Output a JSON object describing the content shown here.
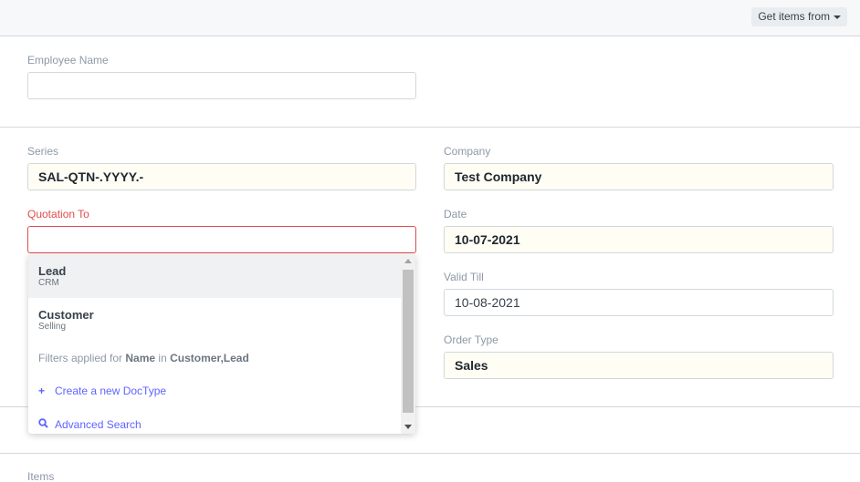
{
  "toolbar": {
    "get_items_label": "Get items from"
  },
  "employee": {
    "label": "Employee Name",
    "value": ""
  },
  "series": {
    "label": "Series",
    "value": "SAL-QTN-.YYYY.-"
  },
  "quotation_to": {
    "label": "Quotation To",
    "value": ""
  },
  "company": {
    "label": "Company",
    "value": "Test Company"
  },
  "date": {
    "label": "Date",
    "value": "10-07-2021"
  },
  "valid_till": {
    "label": "Valid Till",
    "value": "10-08-2021"
  },
  "order_type": {
    "label": "Order Type",
    "value": "Sales"
  },
  "dropdown": {
    "items": [
      {
        "title": "Lead",
        "subtitle": "CRM"
      },
      {
        "title": "Customer",
        "subtitle": "Selling"
      }
    ],
    "filter": {
      "prefix": "Filters applied for",
      "field": "Name",
      "in": "in",
      "doctypes": "Customer,Lead"
    },
    "create_label": "Create a new DocType",
    "advanced_label": "Advanced Search"
  },
  "items_section": {
    "label": "Items"
  },
  "colors": {
    "link": "#5e64ff",
    "error": "#e24c4c",
    "filled_bg": "#fffdf4"
  }
}
